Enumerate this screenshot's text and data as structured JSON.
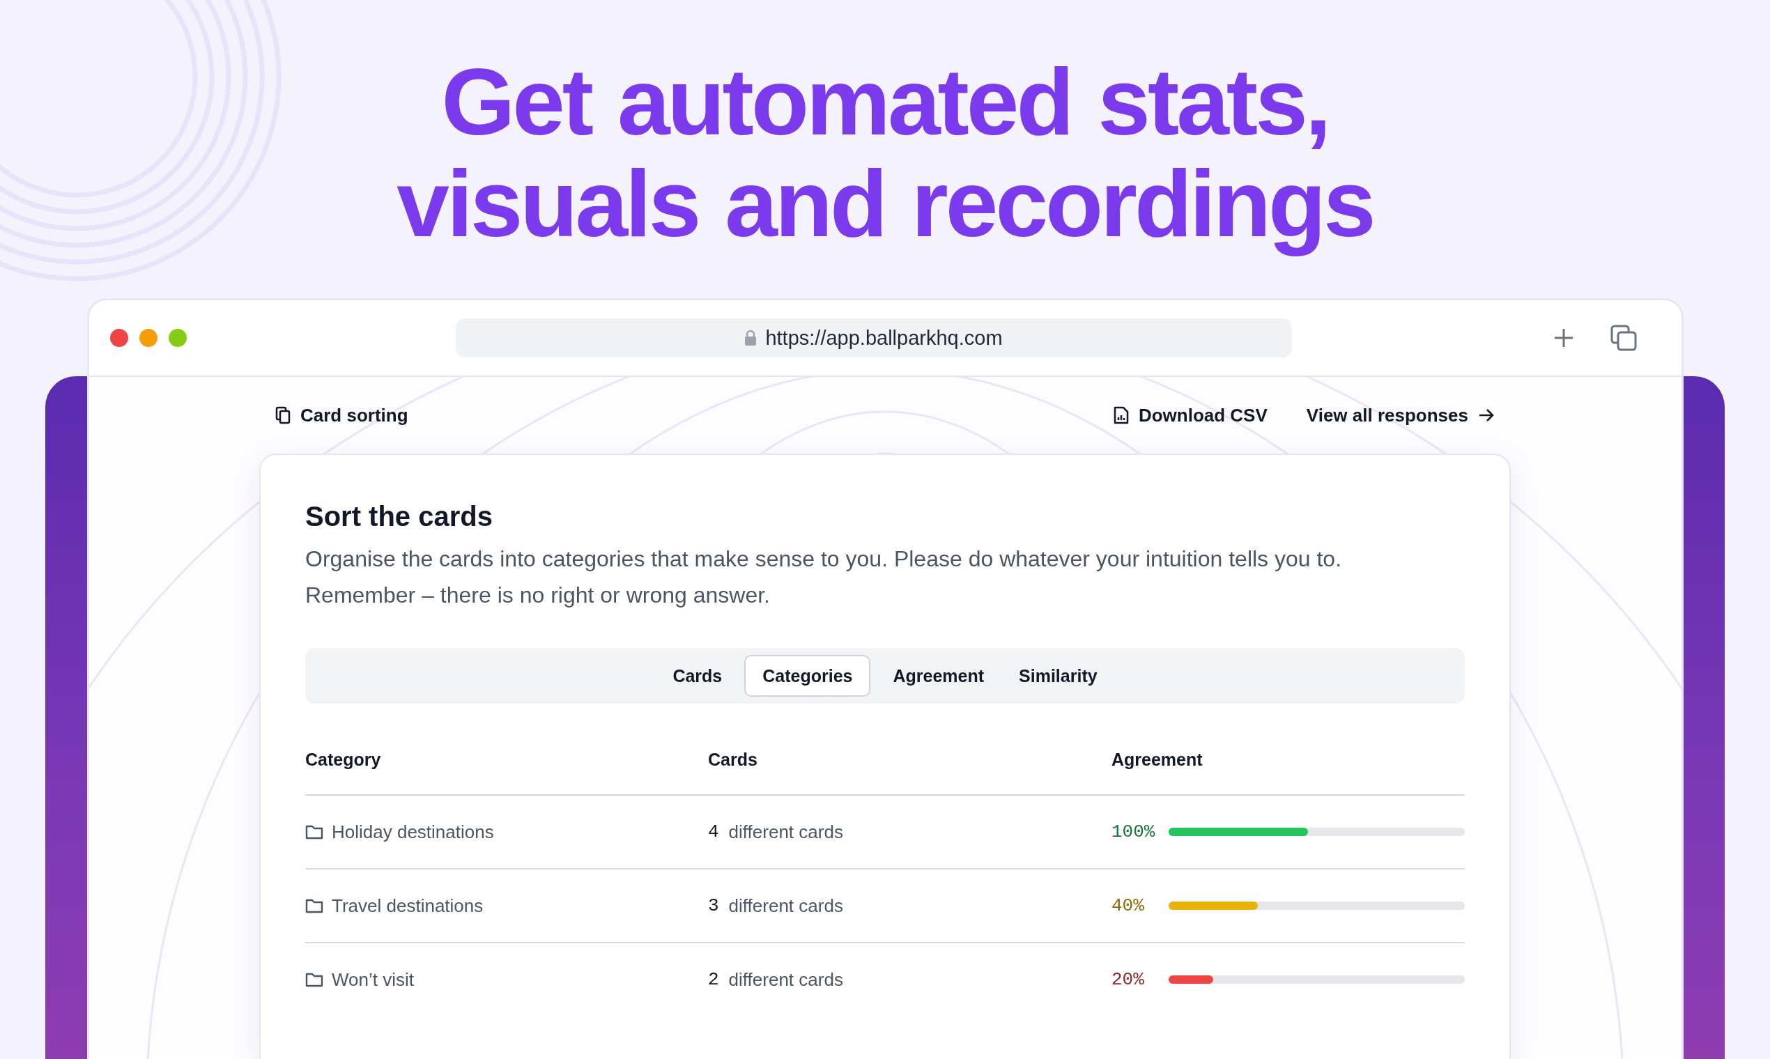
{
  "headline": [
    "Get automated stats,",
    "visuals and recordings"
  ],
  "browser": {
    "url": "https://app.ballparkhq.com"
  },
  "header": {
    "title": "Card sorting",
    "actions": [
      {
        "kind": "download",
        "label": "Download CSV"
      },
      {
        "kind": "link",
        "label": "View all responses"
      }
    ]
  },
  "card": {
    "title": "Sort the cards",
    "description": "Organise the cards into categories that make sense to you. Please do whatever your intuition tells you to. Remember – there is no right or wrong answer."
  },
  "tabs": [
    {
      "label": "Cards",
      "selected": false
    },
    {
      "label": "Categories",
      "selected": true
    },
    {
      "label": "Agreement",
      "selected": false
    },
    {
      "label": "Similarity",
      "selected": false
    }
  ],
  "table": {
    "columns": [
      "Category",
      "Cards",
      "Agreement"
    ],
    "rows": [
      {
        "category": "Holiday destinations",
        "count": "4",
        "cards": "different cards",
        "agreement": "100%",
        "level": 0.47,
        "color": "#22c55e"
      },
      {
        "category": "Travel destinations",
        "count": "3",
        "cards": "different cards",
        "agreement": "40%",
        "level": 0.3,
        "color": "#eab308"
      },
      {
        "category": "Won’t visit",
        "count": "2",
        "cards": "different cards",
        "agreement": "20%",
        "level": 0.15,
        "color": "#ef4444"
      }
    ]
  }
}
